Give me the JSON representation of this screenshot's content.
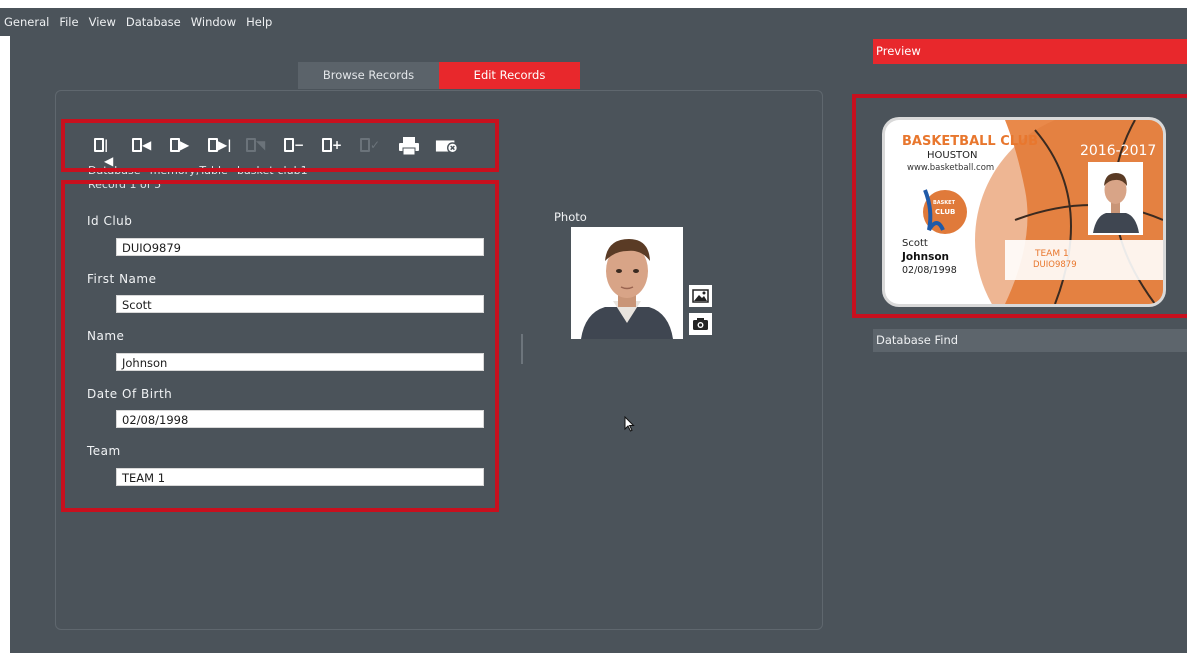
{
  "menu": {
    "items": [
      "General",
      "File",
      "View",
      "Database",
      "Window",
      "Help"
    ]
  },
  "tabs": {
    "browse": "Browse Records",
    "edit": "Edit Records"
  },
  "toolbar": {
    "icons": [
      "first-record-icon",
      "previous-record-icon",
      "next-record-icon",
      "last-record-icon",
      "disabled-record-icon",
      "delete-record-icon",
      "add-record-icon",
      "validate-icon",
      "print-icon",
      "cancel-icon"
    ]
  },
  "info": {
    "database": "Database=memory;Table=basket-club1",
    "record": "Record 1 of 5"
  },
  "fields": [
    {
      "label": "Id Club",
      "value": "DUIO9879"
    },
    {
      "label": "First Name",
      "value": "Scott"
    },
    {
      "label": "Name",
      "value": "Johnson"
    },
    {
      "label": "Date Of Birth",
      "value": "02/08/1998"
    },
    {
      "label": "Team",
      "value": "TEAM 1"
    }
  ],
  "photo": {
    "label": "Photo",
    "buttons": [
      "image-icon",
      "camera-icon"
    ]
  },
  "preview": {
    "header": "Preview",
    "card": {
      "title": "BASKETBALL CLUB",
      "city": "HOUSTON",
      "website": "www.basketball.com",
      "season": "2016-2017",
      "logo_text_top": "BASKET",
      "logo_text_bottom": "CLUB",
      "first_name": "Scott",
      "last_name": "Johnson",
      "dob": "02/08/1998",
      "team": "TEAM 1",
      "id": "DUIO9879"
    }
  },
  "database_find": {
    "header": "Database Find"
  },
  "colors": {
    "accent": "#e8282c",
    "highlight": "#c8101e",
    "background": "#4b535a",
    "card_orange": "#e8772e"
  }
}
